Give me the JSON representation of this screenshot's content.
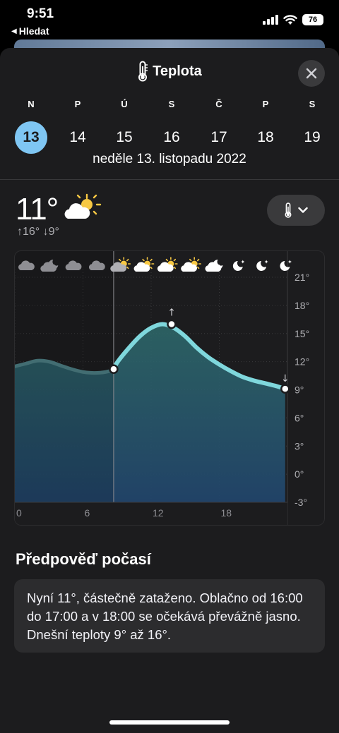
{
  "status_bar": {
    "time": "9:51",
    "back_label": "Hledat",
    "battery": "76"
  },
  "header": {
    "title": "Teplota",
    "icon": "thermometer-icon"
  },
  "week": {
    "days": [
      {
        "letter": "N",
        "num": "13",
        "selected": true
      },
      {
        "letter": "P",
        "num": "14"
      },
      {
        "letter": "Ú",
        "num": "15"
      },
      {
        "letter": "S",
        "num": "16"
      },
      {
        "letter": "Č",
        "num": "17"
      },
      {
        "letter": "P",
        "num": "18"
      },
      {
        "letter": "S",
        "num": "19"
      }
    ],
    "selected_date": "neděle 13. listopadu 2022"
  },
  "current": {
    "temp": "11°",
    "condition_icon": "partly-cloudy-icon",
    "hilo": "↑16° ↓9°"
  },
  "colors": {
    "accent": "#7fc6f3",
    "line": "#7fd7dc",
    "background": "#1c1c1e"
  },
  "chart_data": {
    "type": "area",
    "x_unit": "hour",
    "x_tick_labels": [
      "0",
      "6",
      "12",
      "18"
    ],
    "y_tick_labels": [
      "21°",
      "18°",
      "15°",
      "12°",
      "9°",
      "6°",
      "3°",
      "0°",
      "-3°"
    ],
    "ylim": [
      -3,
      22
    ],
    "grid": true,
    "current_hour": 8.7,
    "series": [
      {
        "x": [
          0,
          1,
          2,
          3,
          4,
          5,
          6,
          7,
          8,
          8.7,
          9,
          10,
          11,
          12,
          13,
          14,
          15,
          16,
          17,
          18,
          19,
          20,
          21,
          22,
          23,
          23.8
        ],
        "values": [
          11.5,
          11.8,
          12.1,
          12.0,
          11.6,
          11.2,
          10.9,
          10.8,
          10.9,
          11.2,
          11.9,
          13.4,
          14.7,
          15.6,
          16.0,
          15.6,
          14.7,
          13.5,
          12.5,
          11.7,
          11.0,
          10.4,
          10.0,
          9.7,
          9.4,
          9.1
        ]
      }
    ],
    "markers": [
      {
        "x": 8.7,
        "value": 11.2,
        "label": "now"
      },
      {
        "x": 13.8,
        "value": 16,
        "label": "↑"
      },
      {
        "x": 23.8,
        "value": 9.1,
        "label": "↓"
      }
    ],
    "hourly_icons": [
      "cloud",
      "partly-cloudy-night",
      "cloud",
      "cloud",
      "partly-sunny",
      "partly-sunny",
      "partly-sunny",
      "partly-sunny",
      "partly-cloudy-night",
      "moon",
      "moon",
      "moon"
    ]
  },
  "forecast": {
    "title": "Předpověď počasí",
    "text": "Nyní 11°, částečně zataženo. Oblačno od 16:00 do 17:00 a v 18:00 se očekává převážně jasno. Dnešní teploty 9° až 16°."
  }
}
